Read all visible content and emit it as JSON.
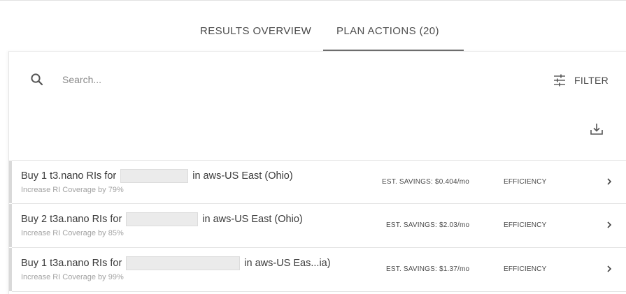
{
  "tabs": [
    {
      "label": "RESULTS OVERVIEW",
      "active": false
    },
    {
      "label": "PLAN ACTIONS (20)",
      "active": true
    }
  ],
  "search": {
    "placeholder": "Search...",
    "value": ""
  },
  "toolbar": {
    "filter_label": "FILTER",
    "download_icon": "download-icon",
    "filter_icon": "sliders-icon",
    "search_icon": "search-icon"
  },
  "actions": [
    {
      "title_prefix": "Buy 1 t3.nano RIs for",
      "title_suffix": "in aws-US East (Ohio)",
      "subtitle": "Increase RI Coverage by 79%",
      "savings": "EST. SAVINGS: $0.404/mo",
      "category": "EFFICIENCY"
    },
    {
      "title_prefix": "Buy 2 t3a.nano RIs for",
      "title_suffix": "in aws-US East (Ohio)",
      "subtitle": "Increase RI Coverage by 85%",
      "savings": "EST. SAVINGS: $2.03/mo",
      "category": "EFFICIENCY"
    },
    {
      "title_prefix": "Buy 1 t3a.nano RIs for",
      "title_suffix": "in aws-US Eas...ia)",
      "subtitle": "Increase RI Coverage by 99%",
      "savings": "EST. SAVINGS: $1.37/mo",
      "category": "EFFICIENCY"
    }
  ],
  "colors": {
    "text": "#3a3a3a",
    "muted": "#a3a3a3",
    "tab_underline": "#6f6f6f",
    "row_accent": "#d9d9d9",
    "mask": "#ebebeb"
  }
}
